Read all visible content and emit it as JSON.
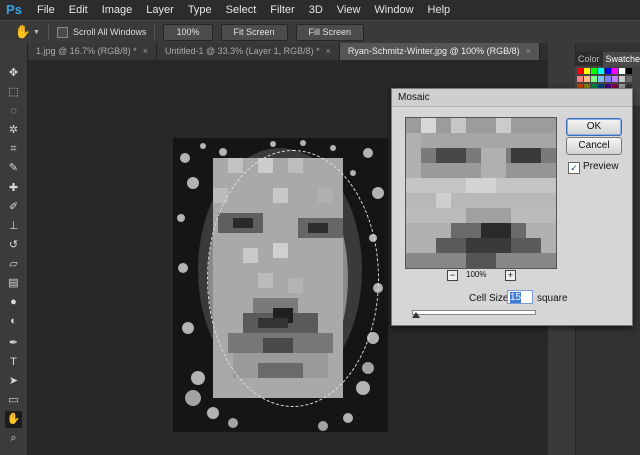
{
  "app": {
    "logo": "Ps"
  },
  "menu": [
    "File",
    "Edit",
    "Image",
    "Layer",
    "Type",
    "Select",
    "Filter",
    "3D",
    "View",
    "Window",
    "Help"
  ],
  "options_bar": {
    "scroll_all_windows": "Scroll All Windows",
    "buttons": [
      "100%",
      "Fit Screen",
      "Fill Screen"
    ]
  },
  "tabs": [
    {
      "label": "1.jpg @ 16.7% (RGB/8) *",
      "active": false
    },
    {
      "label": "Untitled-1 @ 33.3% (Layer 1, RGB/8) *",
      "active": false
    },
    {
      "label": "Ryan-Schmitz-Winter.jpg @ 100% (RGB/8)",
      "active": true
    }
  ],
  "panel_tabs": [
    "Color",
    "Swatches"
  ],
  "dialog": {
    "title": "Mosaic",
    "ok": "OK",
    "cancel": "Cancel",
    "preview_label": "Preview",
    "preview_checked": true,
    "zoom": "100%",
    "zoom_out": "−",
    "zoom_in": "+",
    "cell_size_label": "Cell Size:",
    "cell_size_value": "15",
    "cell_size_unit": "square"
  },
  "tools": [
    "move-tool",
    "marquee-tool",
    "lasso-tool",
    "quick-select-tool",
    "crop-tool",
    "eyedropper-tool",
    "healing-tool",
    "brush-tool",
    "clone-stamp-tool",
    "history-brush-tool",
    "eraser-tool",
    "gradient-tool",
    "blur-tool",
    "dodge-tool",
    "pen-tool",
    "type-tool",
    "path-select-tool",
    "rectangle-tool",
    "hand-tool",
    "zoom-tool"
  ],
  "colors": {
    "accent": "#3aa0e8",
    "bg": "#282828",
    "dialog": "#d6d6d6"
  }
}
